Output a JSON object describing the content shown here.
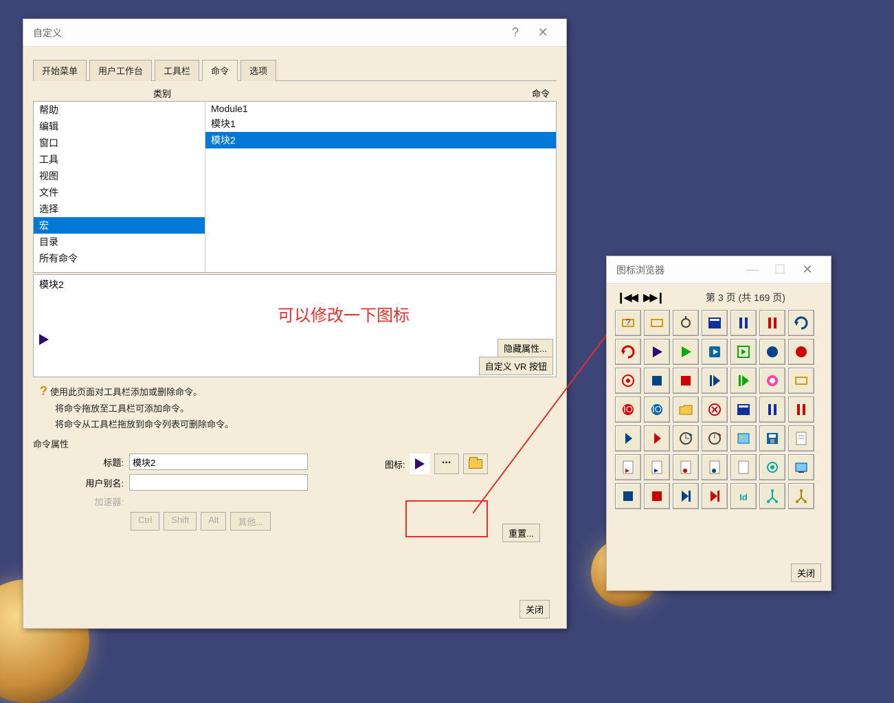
{
  "main": {
    "title": "自定义",
    "tabs": [
      "开始菜单",
      "用户工作台",
      "工具栏",
      "命令",
      "选项"
    ],
    "activeTab": 3,
    "colHeaders": {
      "left": "类别",
      "right": "命令"
    },
    "categories": [
      "帮助",
      "编辑",
      "窗口",
      "工具",
      "视图",
      "文件",
      "选择",
      "宏",
      "目录",
      "所有命令"
    ],
    "categorySelected": 7,
    "commands": [
      "Module1",
      "模块1",
      "模块2"
    ],
    "commandSelected": 2,
    "previewTitle": "模块2",
    "hidePropsBtn": "隐藏属性...",
    "vrBtn": "自定义 VR 按钮",
    "help": {
      "line1": "使用此页面对工具栏添加或删除命令。",
      "line2": "将命令拖放至工具栏可添加命令。",
      "line3": "将命令从工具栏拖放到命令列表可删除命令。"
    },
    "group": {
      "label": "命令属性",
      "titleLabel": "标题:",
      "titleValue": "模块2",
      "aliasLabel": "用户别名:",
      "aliasValue": "",
      "accelLabel": "加速器:",
      "modBtns": [
        "Ctrl",
        "Shift",
        "Alt",
        "其他..."
      ],
      "iconLabel": "图标:"
    },
    "resetBtn": "重置...",
    "closeBtn": "关闭"
  },
  "annotation": "可以修改一下图标",
  "iconBrowser": {
    "title": "图标浏览器",
    "pageInfo": "第 3 页 (共 169 页)",
    "closeBtn": "关闭"
  }
}
